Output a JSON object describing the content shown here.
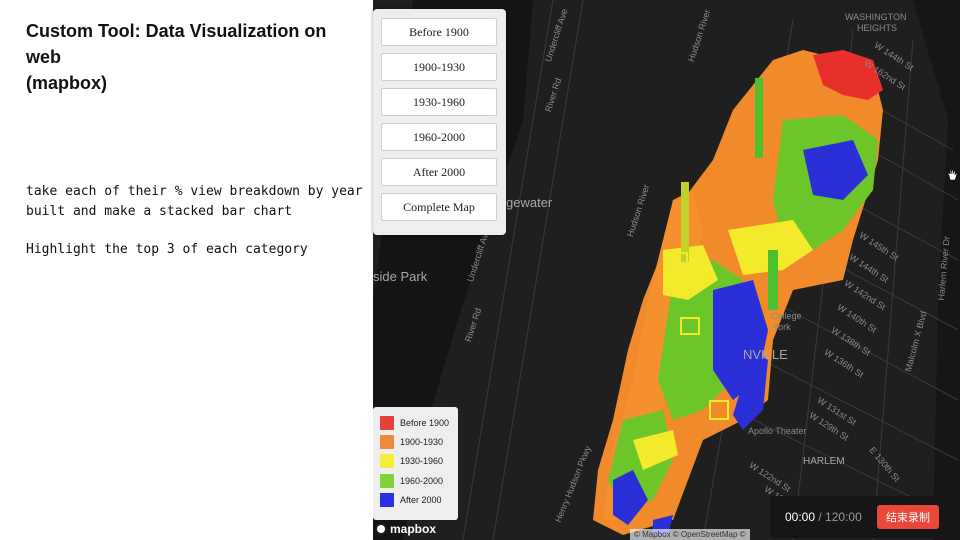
{
  "slide": {
    "title": "Custom Tool: Data Visualization on web\n (mapbox)",
    "note_1": "take each of their % view breakdown by year\nbuilt and make a stacked bar chart",
    "note_2": "Highlight the top 3 of each category"
  },
  "map": {
    "era_buttons": [
      "Before 1900",
      "1900-1930",
      "1930-1960",
      "1960-2000",
      "After 2000",
      "Complete Map"
    ],
    "legend": [
      {
        "label": "Before 1900",
        "color": "#e8403a"
      },
      {
        "label": "1900-1930",
        "color": "#f08a3a"
      },
      {
        "label": "1930-1960",
        "color": "#f2ee3a"
      },
      {
        "label": "1960-2000",
        "color": "#7fd43a"
      },
      {
        "label": "After 2000",
        "color": "#2a2fe0"
      }
    ],
    "labels": {
      "washington": "WASHINGTON",
      "heights": "HEIGHTS",
      "edgewater": "gewater",
      "side_park": "side Park",
      "manhattanville": "NVILLE",
      "harlem": "HARLEM",
      "apollo": "Apollo Theater",
      "college": "College",
      "york": "York",
      "river_rd_1": "River Rd",
      "river_rd_2": "River Rd",
      "river_rd_3": "River Rd",
      "undercliff_1": "Undercliff Ave",
      "undercliff_2": "Undercliff Ave",
      "hudson_river": "Hudson River",
      "hudson_river_2": "Hudson River",
      "hudson_pkwy": "Henry Hudson Pkwy",
      "harlem_river_dr": "Harlem River Dr",
      "malcolm_x": "Malcolm X Blvd",
      "w145": "W 145th St",
      "w144": "W 144th St",
      "w142": "W 142nd St",
      "w140": "W 140th St",
      "w138": "W 138th St",
      "w136": "W 136th St",
      "w131": "W 131st St",
      "w129": "W 129th St",
      "w122": "W 122nd St",
      "w120": "W 120th St",
      "w144b": "W 144th St",
      "w162": "W 162nd St",
      "w130": "E 130th St"
    },
    "logo": "mapbox",
    "attribution": "© Mapbox © OpenStreetMap ©"
  },
  "recorder": {
    "elapsed": "00:00",
    "separator": " / ",
    "total": "120:00",
    "stop_label": "结束录制"
  }
}
